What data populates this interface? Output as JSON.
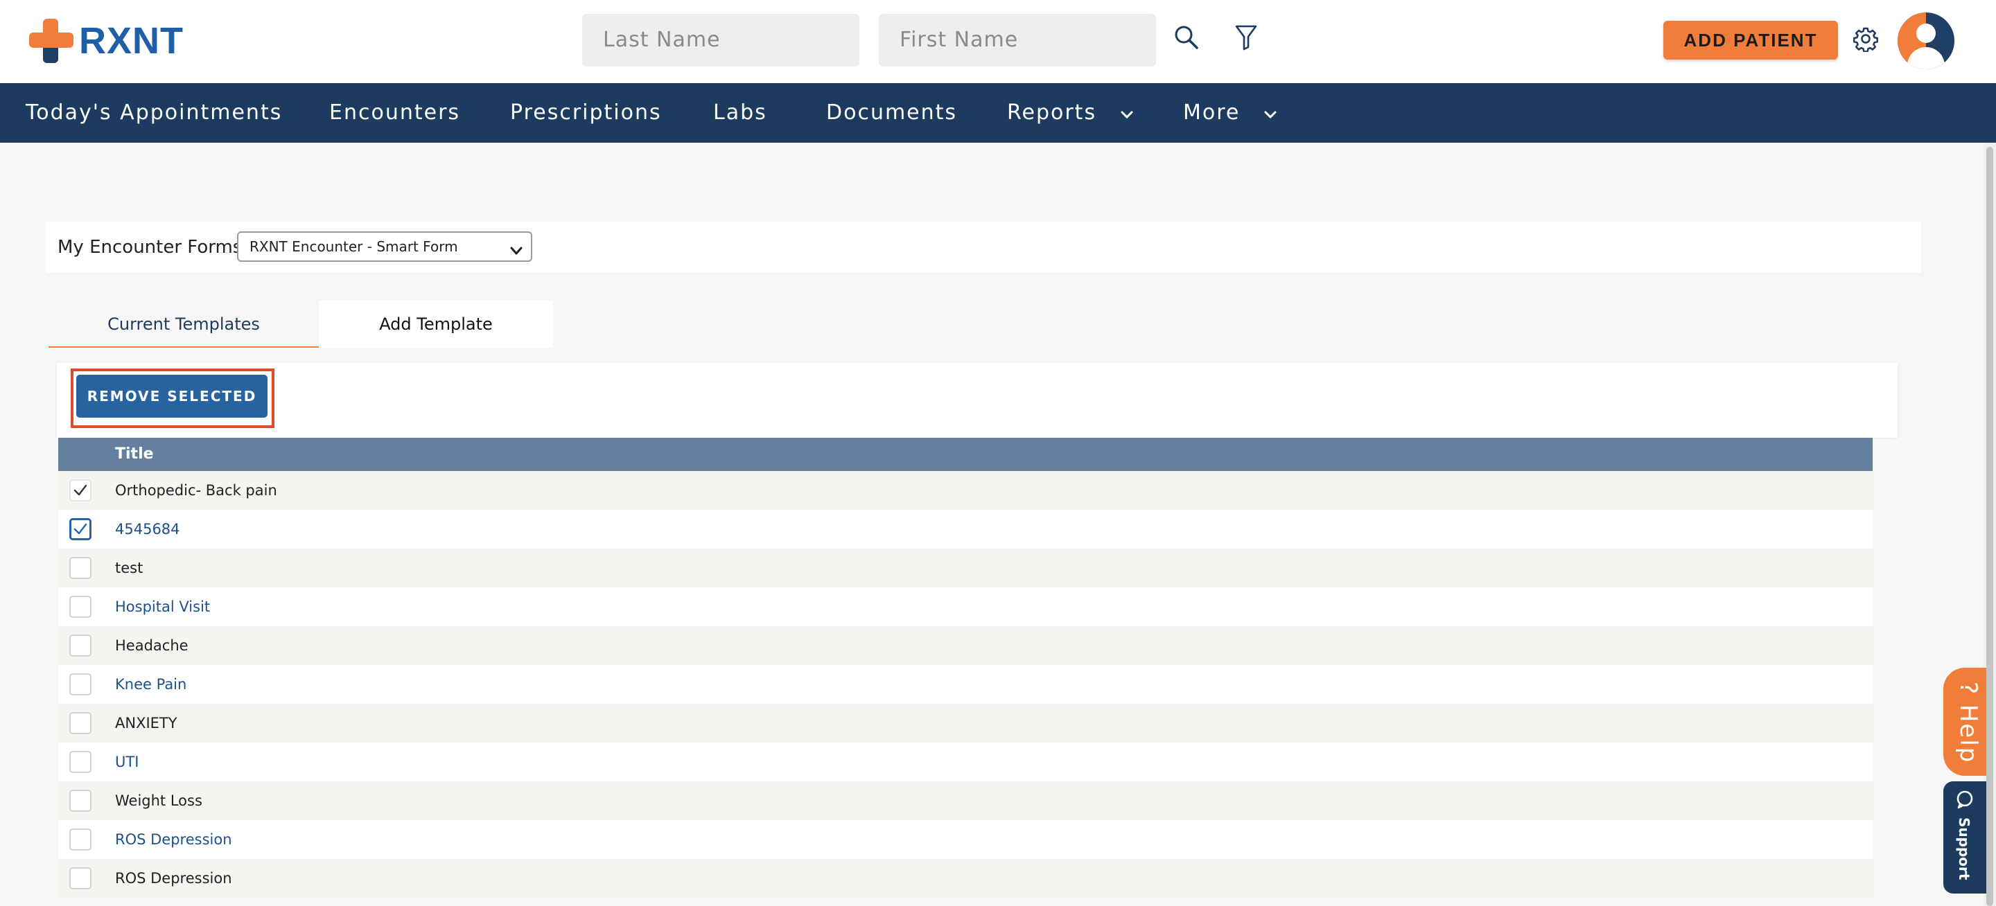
{
  "header": {
    "logo_text": "RXNT",
    "last_name_placeholder": "Last Name",
    "first_name_placeholder": "First Name",
    "add_patient_label": "ADD PATIENT"
  },
  "nav": {
    "items": [
      {
        "label": "Today's Appointments"
      },
      {
        "label": "Encounters"
      },
      {
        "label": "Prescriptions"
      },
      {
        "label": "Labs"
      },
      {
        "label": "Documents"
      },
      {
        "label": "Reports"
      },
      {
        "label": "More"
      }
    ]
  },
  "encounter_forms": {
    "label": "My Encounter Forms:",
    "selected": "RXNT Encounter - Smart Form"
  },
  "tabs": {
    "current": "Current Templates",
    "add": "Add Template"
  },
  "actions": {
    "remove_selected": "REMOVE SELECTED"
  },
  "table": {
    "header_title": "Title",
    "rows": [
      {
        "title": "Orthopedic- Back pain",
        "checked": true,
        "link": false
      },
      {
        "title": "4545684",
        "checked": true,
        "link": true
      },
      {
        "title": "test",
        "checked": false,
        "link": false
      },
      {
        "title": "Hospital Visit",
        "checked": false,
        "link": true
      },
      {
        "title": "Headache",
        "checked": false,
        "link": false
      },
      {
        "title": "Knee Pain",
        "checked": false,
        "link": true
      },
      {
        "title": "ANXIETY",
        "checked": false,
        "link": false
      },
      {
        "title": "UTI",
        "checked": false,
        "link": true
      },
      {
        "title": "Weight Loss",
        "checked": false,
        "link": false
      },
      {
        "title": "ROS Depression",
        "checked": false,
        "link": true
      },
      {
        "title": "ROS Depression",
        "checked": false,
        "link": false
      }
    ]
  },
  "side_tabs": {
    "help": "Help",
    "support": "Support"
  },
  "colors": {
    "brand_orange": "#f07e3a",
    "nav_navy": "#1c3b5e",
    "button_blue": "#2763a0",
    "table_header": "#64809e",
    "highlight_red": "#e24a2c"
  }
}
